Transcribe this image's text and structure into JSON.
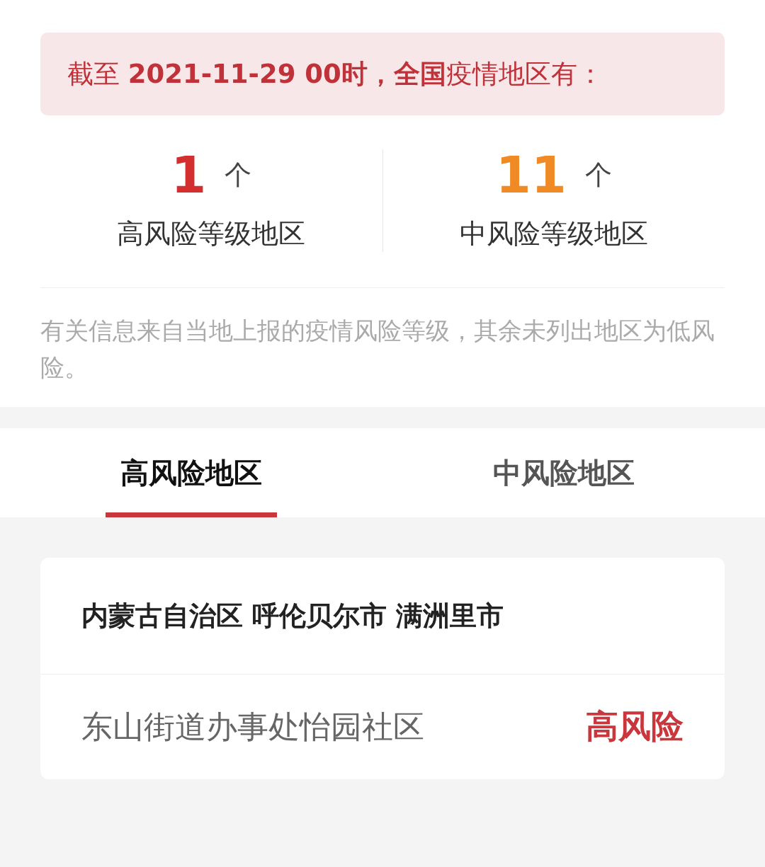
{
  "banner": {
    "text": "截至 **2021-11-29 00时，全国**疫情地区有："
  },
  "stats": [
    {
      "count": "1",
      "unit": "个",
      "label": "高风险等级地区",
      "color": "#d32f2f"
    },
    {
      "count": "11",
      "unit": "个",
      "label": "中风险等级地区",
      "color": "#f08a24"
    }
  ],
  "note": "有关信息来自当地上报的疫情风险等级，其余未列出地区为低风险。",
  "tabs": [
    {
      "label": "高风险地区",
      "selected": true
    },
    {
      "label": "中风险地区",
      "selected": false
    }
  ],
  "regions": [
    {
      "title": "内蒙古自治区 呼伦贝尔市 满洲里市",
      "areas": [
        {
          "name": "东山街道办事处怡园社区",
          "risk": "高风险"
        }
      ]
    }
  ]
}
